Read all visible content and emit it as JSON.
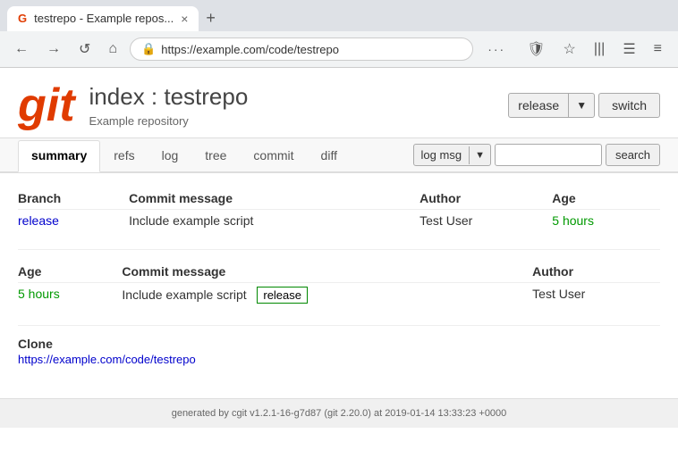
{
  "browser": {
    "tab_icon": "G",
    "tab_title": "testrepo - Example repos...",
    "tab_close": "×",
    "new_tab": "+",
    "url": "https://example.com/code/testrepo",
    "back": "←",
    "forward": "→",
    "refresh": "↺",
    "home": "⌂",
    "more_dots": "···",
    "bookmark_icon": "☆",
    "shield_icon": "🛡",
    "library_icon": "|||",
    "sidebar_icon": "☰",
    "menu_icon": "≡"
  },
  "header": {
    "logo": "git",
    "title": "index : testrepo",
    "description": "Example repository",
    "release_label": "release",
    "release_arrow": "▼",
    "switch_label": "switch"
  },
  "nav": {
    "tabs": [
      {
        "label": "summary",
        "active": true
      },
      {
        "label": "refs"
      },
      {
        "label": "log"
      },
      {
        "label": "tree"
      },
      {
        "label": "commit"
      },
      {
        "label": "diff"
      }
    ],
    "log_msg_label": "log msg",
    "log_msg_arrow": "▼",
    "search_placeholder": "",
    "search_button": "search"
  },
  "summary_table": {
    "headers": [
      "Branch",
      "Commit message",
      "Author",
      "Age"
    ],
    "rows": [
      {
        "branch": "release",
        "commit_message": "Include example script",
        "author": "Test User",
        "age": "5 hours"
      }
    ]
  },
  "tags_table": {
    "headers": [
      "Age",
      "Commit message",
      "Author"
    ],
    "rows": [
      {
        "age": "5 hours",
        "commit_message_prefix": "Include example script",
        "tag_badge": "release",
        "author": "Test User"
      }
    ]
  },
  "clone": {
    "label": "Clone",
    "url": "https://example.com/code/testrepo"
  },
  "footer": {
    "text": "generated by cgit v1.2.1-16-g7d87 (git 2.20.0) at 2019-01-14 13:33:23 +0000"
  }
}
